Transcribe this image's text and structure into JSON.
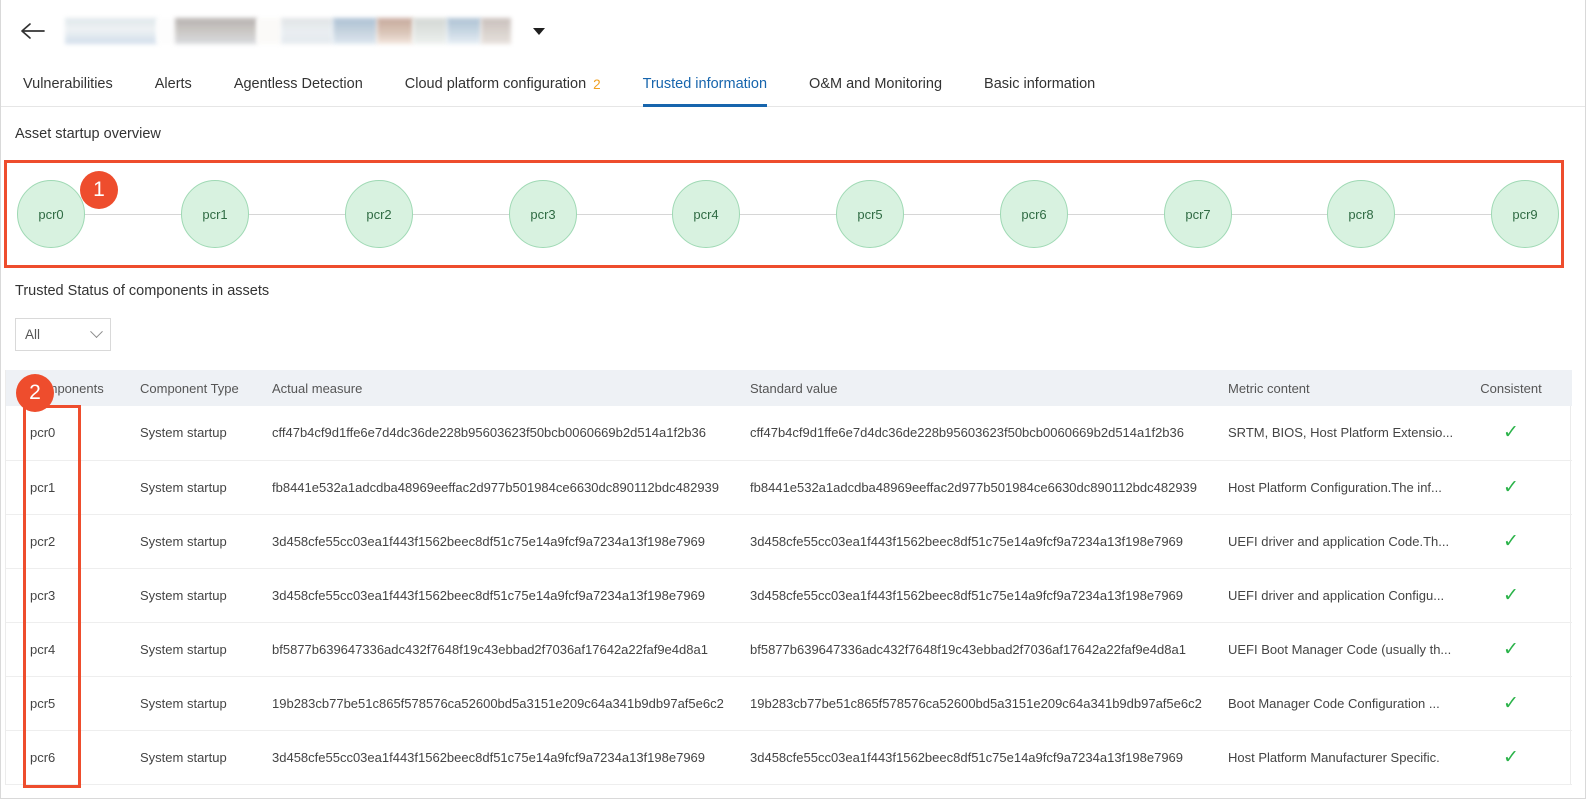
{
  "header": {
    "back_icon": "back-arrow-icon",
    "title_redacted": true,
    "dropdown_icon": "caret-down-icon"
  },
  "tabs": [
    {
      "label": "Vulnerabilities",
      "badge": "",
      "active": false
    },
    {
      "label": "Alerts",
      "badge": "",
      "active": false
    },
    {
      "label": "Agentless Detection",
      "badge": "",
      "active": false
    },
    {
      "label": "Cloud platform configuration",
      "badge": "2",
      "active": false
    },
    {
      "label": "Trusted information",
      "badge": "",
      "active": true
    },
    {
      "label": "O&M and Monitoring",
      "badge": "",
      "active": false
    },
    {
      "label": "Basic information",
      "badge": "",
      "active": false
    }
  ],
  "sections": {
    "asset_startup_overview": "Asset startup overview",
    "trusted_status": "Trusted Status of components in assets"
  },
  "pcr_chain": {
    "nodes": [
      "pcr0",
      "pcr1",
      "pcr2",
      "pcr3",
      "pcr4",
      "pcr5",
      "pcr6",
      "pcr7",
      "pcr8",
      "pcr9"
    ]
  },
  "filter": {
    "selected": "All",
    "chevron_icon": "chevron-down-icon"
  },
  "table": {
    "columns": [
      "Components",
      "Component Type",
      "Actual measure",
      "Standard value",
      "Metric content",
      "Consistent"
    ],
    "rows": [
      {
        "component": "pcr0",
        "type": "System startup",
        "actual": "cff47b4cf9d1ffe6e7d4dc36de228b95603623f50bcb0060669b2d514a1f2b36",
        "standard": "cff47b4cf9d1ffe6e7d4dc36de228b95603623f50bcb0060669b2d514a1f2b36",
        "metric": "SRTM, BIOS, Host Platform Extensio...",
        "consistent": "✓"
      },
      {
        "component": "pcr1",
        "type": "System startup",
        "actual": "fb8441e532a1adcdba48969eeffac2d977b501984ce6630dc890112bdc482939",
        "standard": "fb8441e532a1adcdba48969eeffac2d977b501984ce6630dc890112bdc482939",
        "metric": "Host Platform Configuration.The inf...",
        "consistent": "✓"
      },
      {
        "component": "pcr2",
        "type": "System startup",
        "actual": "3d458cfe55cc03ea1f443f1562beec8df51c75e14a9fcf9a7234a13f198e7969",
        "standard": "3d458cfe55cc03ea1f443f1562beec8df51c75e14a9fcf9a7234a13f198e7969",
        "metric": "UEFI driver and application Code.Th...",
        "consistent": "✓"
      },
      {
        "component": "pcr3",
        "type": "System startup",
        "actual": "3d458cfe55cc03ea1f443f1562beec8df51c75e14a9fcf9a7234a13f198e7969",
        "standard": "3d458cfe55cc03ea1f443f1562beec8df51c75e14a9fcf9a7234a13f198e7969",
        "metric": "UEFI driver and application Configu...",
        "consistent": "✓"
      },
      {
        "component": "pcr4",
        "type": "System startup",
        "actual": "bf5877b639647336adc432f7648f19c43ebbad2f7036af17642a22faf9e4d8a1",
        "standard": "bf5877b639647336adc432f7648f19c43ebbad2f7036af17642a22faf9e4d8a1",
        "metric": "UEFI Boot Manager Code (usually th...",
        "consistent": "✓"
      },
      {
        "component": "pcr5",
        "type": "System startup",
        "actual": "19b283cb77be51c865f578576ca52600bd5a3151e209c64a341b9db97af5e6c2",
        "standard": "19b283cb77be51c865f578576ca52600bd5a3151e209c64a341b9db97af5e6c2",
        "metric": "Boot Manager Code Configuration ...",
        "consistent": "✓"
      },
      {
        "component": "pcr6",
        "type": "System startup",
        "actual": "3d458cfe55cc03ea1f443f1562beec8df51c75e14a9fcf9a7234a13f198e7969",
        "standard": "3d458cfe55cc03ea1f443f1562beec8df51c75e14a9fcf9a7234a13f198e7969",
        "metric": "Host Platform Manufacturer Specific.",
        "consistent": "✓"
      }
    ]
  },
  "annotations": [
    {
      "number": "1"
    },
    {
      "number": "2"
    }
  ],
  "colors": {
    "accent_blue": "#1765ad",
    "annotation_orange": "#ee4d2d",
    "node_fill": "#d8f2e0",
    "node_border": "#9fd9b4",
    "node_text": "#2f6b43",
    "check_green": "#2bb34a",
    "badge_amber": "#f0a020"
  }
}
